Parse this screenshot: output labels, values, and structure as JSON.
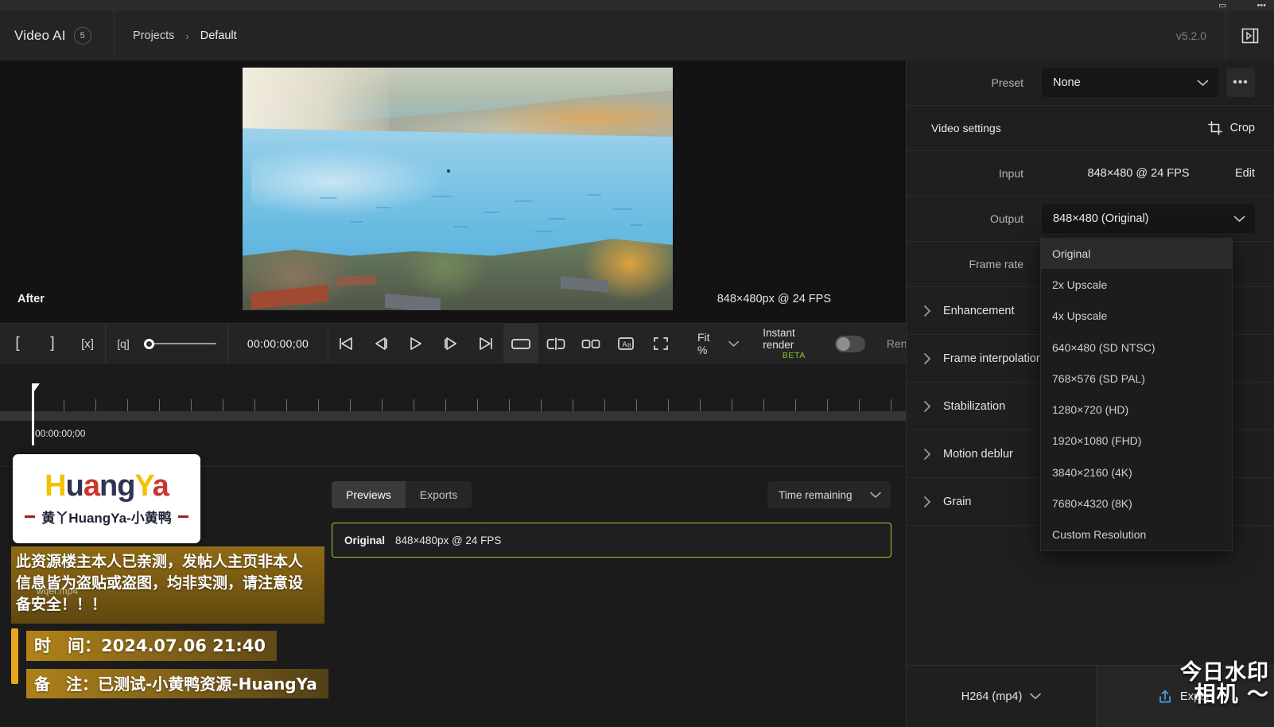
{
  "window": {
    "chrome_icons": [
      "minimize-icon",
      "more-icon"
    ]
  },
  "topbar": {
    "app_name": "Video AI",
    "badge_count": "5",
    "breadcrumb": {
      "root": "Projects",
      "separator": "›",
      "current": "Default"
    },
    "version": "v5.2.0",
    "panel_toggle_icon": "panel-right-icon"
  },
  "viewer": {
    "label": "After",
    "resolution_text": "848×480px @ 24 FPS"
  },
  "transport": {
    "mark_in": "[",
    "mark_out": "]",
    "clear_marks": "[x]",
    "zoom_icon": "[q]",
    "timecode": "00:00:00;00",
    "buttons": [
      "skip-start-icon",
      "step-back-icon",
      "play-icon",
      "step-forward-icon",
      "skip-end-icon"
    ],
    "view_modes": [
      "single-view-icon",
      "split-view-icon",
      "side-by-side-icon",
      "compare-ab-icon",
      "fullscreen-icon"
    ],
    "fit_label": "Fit %",
    "instant_render_label": "Instant render",
    "instant_render_beta": "BETA",
    "instant_render_enabled": false,
    "render_cut_text": "Ren"
  },
  "timeline": {
    "start_timecode": "00:00:00;00"
  },
  "bottom": {
    "tabs": [
      {
        "label": "Previews",
        "selected": true
      },
      {
        "label": "Exports",
        "selected": false
      }
    ],
    "sort_dropdown": "Time remaining",
    "previews": [
      {
        "name": "Original",
        "meta": "848×480px @ 24 FPS",
        "highlighted": true
      }
    ]
  },
  "right_panel": {
    "preset": {
      "label": "Preset",
      "value": "None",
      "more_label": "•••"
    },
    "video_settings": {
      "label": "Video settings",
      "crop_label": "Crop"
    },
    "input": {
      "label": "Input",
      "value": "848×480 @ 24 FPS",
      "edit_label": "Edit"
    },
    "output": {
      "label": "Output",
      "value": "848×480 (Original)"
    },
    "frame_rate": {
      "label": "Frame rate"
    },
    "output_options": [
      {
        "label": "Original",
        "highlighted": true
      },
      {
        "label": "2x Upscale",
        "highlighted": false
      },
      {
        "label": "4x Upscale",
        "highlighted": false
      },
      {
        "label": "640×480 (SD NTSC)",
        "highlighted": false
      },
      {
        "label": "768×576 (SD PAL)",
        "highlighted": false
      },
      {
        "label": "1280×720 (HD)",
        "highlighted": false
      },
      {
        "label": "1920×1080 (FHD)",
        "highlighted": false
      },
      {
        "label": "3840×2160 (4K)",
        "highlighted": false
      },
      {
        "label": "7680×4320 (8K)",
        "highlighted": false
      },
      {
        "label": "Custom Resolution",
        "highlighted": false
      }
    ],
    "accordions": [
      {
        "label": "Enhancement"
      },
      {
        "label": "Frame interpolation"
      },
      {
        "label": "Stabilization"
      },
      {
        "label": "Motion deblur"
      },
      {
        "label": "Grain"
      }
    ],
    "export_bar": {
      "codec": "H264 (mp4)",
      "export_label": "Export",
      "export_icon": "share-upload-icon"
    }
  },
  "watermark": {
    "logo_parts": [
      "H",
      "u",
      "a",
      "ng",
      "Y",
      "a"
    ],
    "subtitle": "黄丫HuangYa-小黄鸭",
    "note_lines": [
      "此资源楼主本人已亲测，发帖人主页非本人",
      "信息皆为盗贴或盗图，均非实测，请注意设",
      "备安全！！！"
    ],
    "filename": "wqer.mp4",
    "time_text": "时　间：2024.07.06 21:40",
    "remark_text": "备　注：已测试-小黄鸭资源-HuangYa",
    "corner_line1": "今日水印",
    "corner_line2": "相机 ～"
  },
  "colors": {
    "accent_green": "#9acd32",
    "beta_green": "#86c232",
    "panel_bg": "#1f1f1f",
    "topbar_bg": "#242424"
  }
}
